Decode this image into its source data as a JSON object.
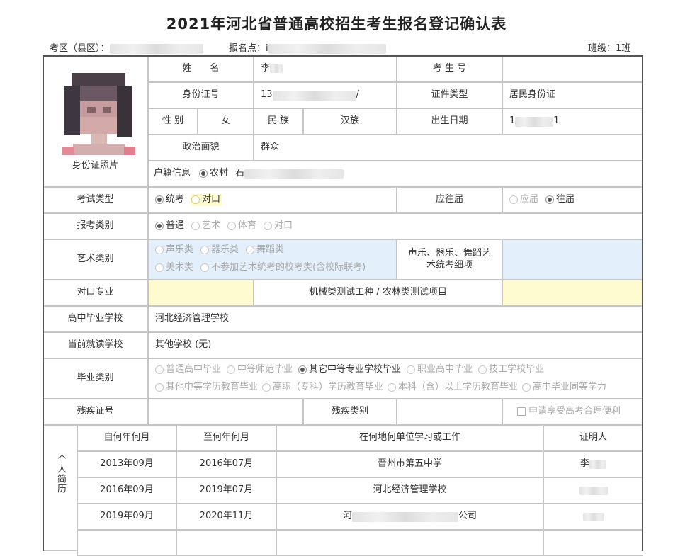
{
  "title": "2021年河北省普通高校招生考生报名登记确认表",
  "header": {
    "exam_area_label": "考区（县区）：",
    "exam_point_label": "报名点：",
    "exam_point_prefix": "i",
    "class_label": "班级：1班"
  },
  "photo_label": "身份证照片",
  "fields": {
    "name_label": "姓　　名",
    "name_value": "李",
    "exam_no_label": "考 生 号",
    "exam_no_value": "",
    "id_label": "身份证号",
    "id_value_start": "13",
    "id_value_end": "/",
    "cert_type_label": "证件类型",
    "cert_type_value": "居民身份证",
    "gender_label": "性 别",
    "gender_value": "女",
    "ethnic_label": "民 族",
    "ethnic_value": "汉族",
    "birth_label": "出生日期",
    "birth_value_start": "1",
    "birth_value_end": "1",
    "political_label": "政治面貌",
    "political_value": "群众",
    "huji_label": "户籍信息",
    "huji_option": "农村",
    "huji_place": "石"
  },
  "exam_type": {
    "label": "考试类型",
    "options": [
      "统考",
      "对口"
    ],
    "yingwang_label": "应往届",
    "yingwang_options": [
      "应届",
      "往届"
    ]
  },
  "apply_category": {
    "label": "报考类别",
    "options": [
      "普通",
      "艺术",
      "体育",
      "对口"
    ]
  },
  "art_category": {
    "label": "艺术类别",
    "options_row1": [
      "声乐类",
      "器乐类",
      "舞蹈类"
    ],
    "options_row2": [
      "美术类",
      "不参加艺术统考的校考类(含校际联考)"
    ],
    "detail_label": "声乐、器乐、舞蹈艺术统考细项"
  },
  "duikou": {
    "label": "对口专业",
    "test_label": "机械类测试工种 / 农林类测试项目"
  },
  "school": {
    "hs_label": "高中毕业学校",
    "hs_value": "河北经济管理学校",
    "current_label": "当前就读学校",
    "current_value": "其他学校 (无)"
  },
  "graduation": {
    "label": "毕业类别",
    "options_row1": [
      "普通高中毕业",
      "中等师范毕业",
      "其它中等专业学校毕业",
      "职业高中毕业",
      "技工学校毕业"
    ],
    "options_row2": [
      "其他中等学历教育毕业",
      "高职（专科）学历教育毕业",
      "本科（含）以上学历教育毕业",
      "高中毕业同等学力"
    ]
  },
  "disability": {
    "cert_label": "残疾证号",
    "type_label": "残疾类别",
    "apply_label": "申请享受高考合理便利"
  },
  "resume": {
    "side_label": "个人简历",
    "headers": [
      "自何年何月",
      "至何年何月",
      "在何地何单位学习或工作",
      "证明人"
    ],
    "rows": [
      {
        "from": "2013年09月",
        "to": "2016年07月",
        "place": "晋州市第五中学",
        "witness": "李"
      },
      {
        "from": "2016年09月",
        "to": "2019年07月",
        "place": "河北经济管理学校",
        "witness": ""
      },
      {
        "from": "2019年09月",
        "to": "2020年11月",
        "place_start": "河",
        "place_end": "公司",
        "witness": ""
      }
    ]
  }
}
